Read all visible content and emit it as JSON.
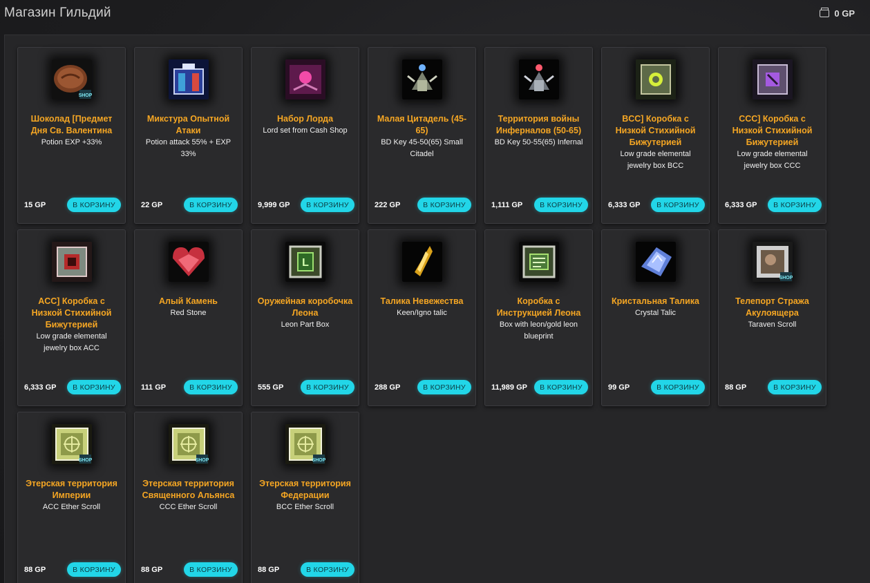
{
  "header": {
    "title": "Магазин Гильдий",
    "balance": "0 GP"
  },
  "colors": {
    "accent": "#22d6e8",
    "item_name": "#f5a623",
    "background": "#1c1c1e"
  },
  "items": [
    {
      "name": "Шоколад [Предмет Дня Св. Валентина",
      "desc": "Potion EXP +33%",
      "price": "15 GP",
      "button": "В КОРЗИНУ",
      "icon": "chocolate-icon"
    },
    {
      "name": "Микстура Опытной Атаки",
      "desc": "Potion attack 55% + EXP 33%",
      "price": "22 GP",
      "button": "В КОРЗИНУ",
      "icon": "potion-icon"
    },
    {
      "name": "Набор Лорда",
      "desc": "Lord set from Cash Shop",
      "price": "9,999 GP",
      "button": "В КОРЗИНУ",
      "icon": "lord-set-icon"
    },
    {
      "name": "Малая Цитадель (45-65)",
      "desc": "BD Key 45-50(65) Small Citadel",
      "price": "222 GP",
      "button": "В КОРЗИНУ",
      "icon": "citadel-icon"
    },
    {
      "name": "Территория войны Инферналов (50-65)",
      "desc": "BD Key 50-55(65) Infernal",
      "price": "1,111 GP",
      "button": "В КОРЗИНУ",
      "icon": "infernal-icon"
    },
    {
      "name": "BCC] Коробка с Низкой Стихийной Бижутерией",
      "desc": "Low grade elemental jewelry box BCC",
      "price": "6,333 GP",
      "button": "В КОРЗИНУ",
      "icon": "jewelry-box-bcc-icon"
    },
    {
      "name": "CCC] Коробка с Низкой Стихийной Бижутерией",
      "desc": "Low grade elemental jewelry box CCC",
      "price": "6,333 GP",
      "button": "В КОРЗИНУ",
      "icon": "jewelry-box-ccc-icon"
    },
    {
      "name": "ACC] Коробка с Низкой Стихийной Бижутерией",
      "desc": "Low grade elemental jewelry box ACC",
      "price": "6,333 GP",
      "button": "В КОРЗИНУ",
      "icon": "jewelry-box-acc-icon"
    },
    {
      "name": "Алый Камень",
      "desc": "Red Stone",
      "price": "111 GP",
      "button": "В КОРЗИНУ",
      "icon": "red-stone-icon"
    },
    {
      "name": "Оружейная коробочка Леона",
      "desc": "Leon Part Box",
      "price": "555 GP",
      "button": "В КОРЗИНУ",
      "icon": "leon-box-icon"
    },
    {
      "name": "Талика Невежества",
      "desc": "Keen/Igno talic",
      "price": "288 GP",
      "button": "В КОРЗИНУ",
      "icon": "talic-icon"
    },
    {
      "name": "Коробка с Инструкцией Леона",
      "desc": "Box with leon/gold leon blueprint",
      "price": "11,989 GP",
      "button": "В КОРЗИНУ",
      "icon": "blueprint-box-icon"
    },
    {
      "name": "Кристальная Талика",
      "desc": "Crystal Talic",
      "price": "99 GP",
      "button": "В КОРЗИНУ",
      "icon": "crystal-talic-icon"
    },
    {
      "name": "Телепорт Стража Акулоящера",
      "desc": "Taraven Scroll",
      "price": "88 GP",
      "button": "В КОРЗИНУ",
      "icon": "teleport-scroll-icon"
    },
    {
      "name": "Этерская территория Империи",
      "desc": "ACC Ether Scroll",
      "price": "88 GP",
      "button": "В КОРЗИНУ",
      "icon": "ether-scroll-icon"
    },
    {
      "name": "Этерская территория Священного Альянса",
      "desc": "CCC Ether Scroll",
      "price": "88 GP",
      "button": "В КОРЗИНУ",
      "icon": "ether-scroll-icon"
    },
    {
      "name": "Этерская территория Федерации",
      "desc": "BCC Ether Scroll",
      "price": "88 GP",
      "button": "В КОРЗИНУ",
      "icon": "ether-scroll-icon"
    }
  ]
}
